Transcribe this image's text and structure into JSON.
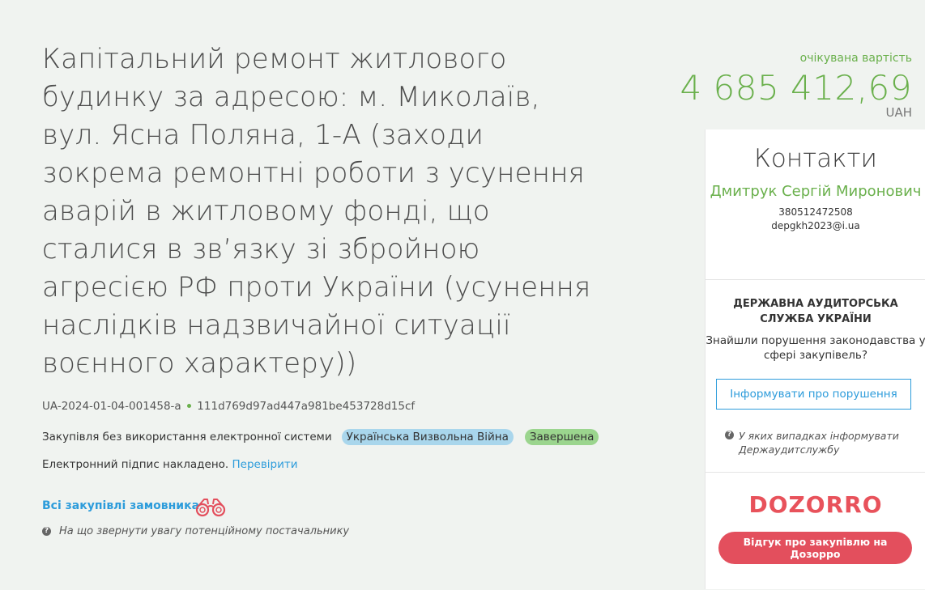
{
  "tender": {
    "title": "Капітальний ремонт житлового будинку за адресою: м. Миколаїв, вул. Ясна Поляна, 1-А (заходи зокрема ремонтні роботи з усунення аварій в житловому фонді, що сталися в зв’язку зі збройною агресією РФ проти України (усунення наслідків надзвичайної ситуації воєнного характеру))",
    "tender_id": "UA-2024-01-04-001458-a",
    "hash": "111d769d97ad447a981be453728d15cf",
    "procedure_type": "Закупівля без використання електронної системи",
    "tag_label": "Українська Визвольна Війна",
    "status_label": "Завершена",
    "signature_text": "Електронний підпис накладено.",
    "signature_check_link": "Перевірити",
    "all_purchases_link": "Всі закупівлі замовника",
    "supplier_hint": "На що звернути увагу потенційному постачальнику"
  },
  "price": {
    "label": "очікувана вартість",
    "value": "4 685 412,69",
    "currency": "UAH"
  },
  "contacts": {
    "heading": "Контакти",
    "name": "Дмитрук Сергій Миронович",
    "phone": "380512472508",
    "email": "depgkh2023@i.ua"
  },
  "audit": {
    "title": "ДЕРЖАВНА АУДИТОРСЬКА СЛУЖБА УКРАЇНИ",
    "text": "Знайшли порушення законодавства у сфері закупівель?",
    "button_label": "Інформувати про порушення",
    "hint": "У яких випадках інформувати Держаудитслужбу"
  },
  "dozorro": {
    "logo_text": "DOZORRO",
    "button_label": "Відгук про закупівлю на Дозорро"
  },
  "colors": {
    "accent_green": "#6ab04c",
    "link_blue": "#2d9cdb",
    "dozorro_red": "#e34f5d"
  }
}
